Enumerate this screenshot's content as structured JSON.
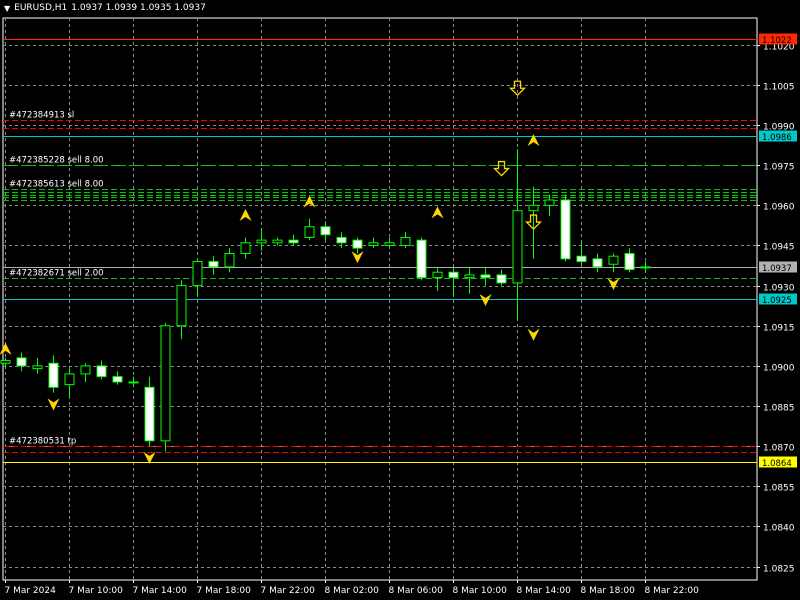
{
  "header": {
    "symbol": "EURUSD,H1",
    "ohlc": "1.0937 1.0939 1.0935 1.0937"
  },
  "colors": {
    "background": "#000000",
    "grid": "#8a8a8a",
    "frame": "#ffffff",
    "bull_body": "#000000",
    "bear_body": "#ffffff",
    "candle_outline": "#00ff00",
    "wick": "#00ff00",
    "sell_line": "#00c800",
    "sl_line": "#ff0000",
    "tp_line": "#ff0000",
    "arrow": "#ffd700",
    "bid_line": "#b0b0b0",
    "cyan_line": "#00c8c8",
    "red_line": "#ff2a00",
    "yellow_line": "#ffff00"
  },
  "chart_data": {
    "type": "candlestick",
    "title": "EURUSD,H1",
    "ylim": [
      1.082,
      1.103
    ],
    "y_ticks": [
      "1.1020",
      "1.1005",
      "1.0990",
      "1.0975",
      "1.0960",
      "1.0945",
      "1.0930",
      "1.0915",
      "1.0900",
      "1.0885",
      "1.0870",
      "1.0855",
      "1.0840",
      "1.0825"
    ],
    "x_ticks": [
      "7 Mar 2024",
      "7 Mar 10:00",
      "7 Mar 14:00",
      "7 Mar 18:00",
      "7 Mar 22:00",
      "8 Mar 02:00",
      "8 Mar 06:00",
      "8 Mar 10:00",
      "8 Mar 14:00",
      "8 Mar 18:00",
      "8 Mar 22:00"
    ],
    "grid": true,
    "candles": [
      {
        "o": 1.0901,
        "h": 1.0903,
        "l": 1.0899,
        "c": 1.0902
      },
      {
        "o": 1.0903,
        "h": 1.0905,
        "l": 1.0898,
        "c": 1.09
      },
      {
        "o": 1.0899,
        "h": 1.0903,
        "l": 1.0897,
        "c": 1.09
      },
      {
        "o": 1.0901,
        "h": 1.0904,
        "l": 1.089,
        "c": 1.0892
      },
      {
        "o": 1.0893,
        "h": 1.09,
        "l": 1.0888,
        "c": 1.0897
      },
      {
        "o": 1.0897,
        "h": 1.0901,
        "l": 1.0894,
        "c": 1.09
      },
      {
        "o": 1.09,
        "h": 1.0902,
        "l": 1.0895,
        "c": 1.0896
      },
      {
        "o": 1.0896,
        "h": 1.0898,
        "l": 1.0893,
        "c": 1.0894
      },
      {
        "o": 1.0894,
        "h": 1.0896,
        "l": 1.0892,
        "c": 1.0894
      },
      {
        "o": 1.0892,
        "h": 1.0896,
        "l": 1.087,
        "c": 1.0872
      },
      {
        "o": 1.0872,
        "h": 1.0916,
        "l": 1.0868,
        "c": 1.0915
      },
      {
        "o": 1.0915,
        "h": 1.0932,
        "l": 1.091,
        "c": 1.093
      },
      {
        "o": 1.093,
        "h": 1.094,
        "l": 1.0926,
        "c": 1.0939
      },
      {
        "o": 1.0939,
        "h": 1.0941,
        "l": 1.0934,
        "c": 1.0937
      },
      {
        "o": 1.0937,
        "h": 1.0944,
        "l": 1.0935,
        "c": 1.0942
      },
      {
        "o": 1.0942,
        "h": 1.0948,
        "l": 1.094,
        "c": 1.0946
      },
      {
        "o": 1.0946,
        "h": 1.0951,
        "l": 1.0943,
        "c": 1.0947
      },
      {
        "o": 1.0946,
        "h": 1.0948,
        "l": 1.0945,
        "c": 1.0947
      },
      {
        "o": 1.0947,
        "h": 1.0949,
        "l": 1.0945,
        "c": 1.0946
      },
      {
        "o": 1.0948,
        "h": 1.0955,
        "l": 1.0947,
        "c": 1.0952
      },
      {
        "o": 1.0952,
        "h": 1.0954,
        "l": 1.0947,
        "c": 1.0949
      },
      {
        "o": 1.0948,
        "h": 1.095,
        "l": 1.0944,
        "c": 1.0946
      },
      {
        "o": 1.0947,
        "h": 1.0948,
        "l": 1.0942,
        "c": 1.0944
      },
      {
        "o": 1.0945,
        "h": 1.0948,
        "l": 1.0944,
        "c": 1.0946
      },
      {
        "o": 1.0945,
        "h": 1.0948,
        "l": 1.0944,
        "c": 1.0946
      },
      {
        "o": 1.0945,
        "h": 1.095,
        "l": 1.0944,
        "c": 1.0948
      },
      {
        "o": 1.0947,
        "h": 1.0948,
        "l": 1.0932,
        "c": 1.0933
      },
      {
        "o": 1.0933,
        "h": 1.0937,
        "l": 1.0928,
        "c": 1.0935
      },
      {
        "o": 1.0935,
        "h": 1.0937,
        "l": 1.0926,
        "c": 1.0933
      },
      {
        "o": 1.0933,
        "h": 1.0937,
        "l": 1.0927,
        "c": 1.0934
      },
      {
        "o": 1.0934,
        "h": 1.0937,
        "l": 1.093,
        "c": 1.0933
      },
      {
        "o": 1.0934,
        "h": 1.0936,
        "l": 1.093,
        "c": 1.0931
      },
      {
        "o": 1.0931,
        "h": 1.0981,
        "l": 1.0917,
        "c": 1.0958
      },
      {
        "o": 1.0958,
        "h": 1.0967,
        "l": 1.094,
        "c": 1.096
      },
      {
        "o": 1.096,
        "h": 1.0964,
        "l": 1.0956,
        "c": 1.0962
      },
      {
        "o": 1.0962,
        "h": 1.0964,
        "l": 1.0939,
        "c": 1.094
      },
      {
        "o": 1.0941,
        "h": 1.0946,
        "l": 1.0938,
        "c": 1.0939
      },
      {
        "o": 1.094,
        "h": 1.0942,
        "l": 1.0935,
        "c": 1.0937
      },
      {
        "o": 1.0938,
        "h": 1.0942,
        "l": 1.0935,
        "c": 1.0941
      },
      {
        "o": 1.0942,
        "h": 1.0944,
        "l": 1.0935,
        "c": 1.0936
      },
      {
        "o": 1.0937,
        "h": 1.0939,
        "l": 1.0935,
        "c": 1.0937
      }
    ],
    "levels": [
      {
        "name": "red-line",
        "price": 1.1022,
        "label": "1.1022",
        "color": "red_line",
        "style": "solid"
      },
      {
        "name": "sl-line",
        "price": 1.0992,
        "label": "#472384913 sl",
        "color": "sl_line",
        "style": "dash"
      },
      {
        "name": "sl-line-2",
        "price": 1.0989,
        "label": "",
        "color": "sl_line",
        "style": "dash"
      },
      {
        "name": "cyan-line-top",
        "price": 1.0986,
        "label": "1.0986",
        "color": "cyan_line",
        "style": "solid"
      },
      {
        "name": "sell-line-1",
        "price": 1.0975,
        "label": "#472385228 sell 8.00",
        "color": "sell_line",
        "style": "dash"
      },
      {
        "name": "sell-line-2",
        "price": 1.0966,
        "label": "#472385613 sell 8.00",
        "color": "sell_line",
        "style": "dash"
      },
      {
        "name": "sell-line-3",
        "price": 1.0965,
        "label": "",
        "color": "sell_line",
        "style": "dash"
      },
      {
        "name": "sell-line-4",
        "price": 1.0964,
        "label": "",
        "color": "sell_line",
        "style": "dash"
      },
      {
        "name": "sell-line-5",
        "price": 1.0963,
        "label": "",
        "color": "sell_line",
        "style": "dash"
      },
      {
        "name": "sell-line-6",
        "price": 1.0962,
        "label": "",
        "color": "sell_line",
        "style": "dash"
      },
      {
        "name": "bid-line",
        "price": 1.0937,
        "label": "1.0937",
        "color": "bid_line",
        "style": "solid"
      },
      {
        "name": "sell-line-7",
        "price": 1.0933,
        "label": "#472382671 sell 2.00",
        "color": "sell_line",
        "style": "dash"
      },
      {
        "name": "cyan-line-bottom",
        "price": 1.0925,
        "label": "1.0925",
        "color": "cyan_line",
        "style": "solid"
      },
      {
        "name": "tp-line-1",
        "price": 1.087,
        "label": "#472380531 tp",
        "color": "tp_line",
        "style": "dash"
      },
      {
        "name": "tp-line-2",
        "price": 1.0868,
        "label": "",
        "color": "tp_line",
        "style": "dash"
      },
      {
        "name": "yellow-line",
        "price": 1.0864,
        "label": "1.0864",
        "color": "yellow_line",
        "style": "solid"
      }
    ],
    "arrows": [
      {
        "i": 0,
        "dir": "up",
        "price": 1.0906
      },
      {
        "i": 3,
        "dir": "down",
        "price": 1.0886
      },
      {
        "i": 9,
        "dir": "down",
        "price": 1.0866
      },
      {
        "i": 15,
        "dir": "up",
        "price": 1.0956
      },
      {
        "i": 19,
        "dir": "up",
        "price": 1.0961
      },
      {
        "i": 22,
        "dir": "down",
        "price": 1.0941
      },
      {
        "i": 27,
        "dir": "up",
        "price": 1.0957
      },
      {
        "i": 30,
        "dir": "down",
        "price": 1.0925
      },
      {
        "i": 33,
        "dir": "down",
        "price": 1.0912
      },
      {
        "i": 33,
        "dir": "up",
        "price": 1.0984
      },
      {
        "i": 38,
        "dir": "down",
        "price": 1.0931
      }
    ],
    "hollow_arrows": [
      {
        "i": 32,
        "price": 1.1003
      },
      {
        "i": 31,
        "price": 1.0973
      },
      {
        "i": 33,
        "price": 1.0953
      }
    ]
  }
}
